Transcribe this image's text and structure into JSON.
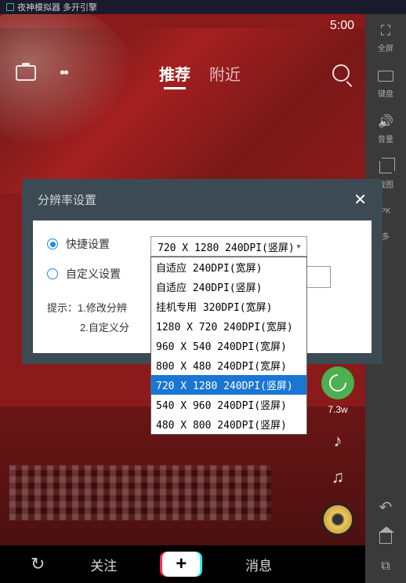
{
  "titlebar": {
    "text": "夜神模拟器 多开引擎"
  },
  "status": {
    "time": "5:00"
  },
  "topnav": {
    "tab_recommend": "推荐",
    "tab_nearby": "附近"
  },
  "right_actions": {
    "count": "7.3w"
  },
  "bottom_nav": {
    "follow": "关注",
    "plus": "+",
    "message": "消息"
  },
  "sidebar": {
    "fullscreen": "全屏",
    "keyboard": "键盘",
    "volume": "音量",
    "screenshot": "截图",
    "apk": "PK",
    "more": "多"
  },
  "modal": {
    "title": "分辨率设置",
    "radio_quick": "快捷设置",
    "radio_custom": "自定义设置",
    "selected_value": "720 X 1280 240DPI(竖屏)",
    "tip_line1": "提示：1.修改分辨",
    "tip_line2": "2.自定义分"
  },
  "dropdown": {
    "options": [
      "自适应 240DPI(宽屏)",
      "自适应 240DPI(竖屏)",
      "挂机专用 320DPI(宽屏)",
      "1280 X 720 240DPI(宽屏)",
      "960 X 540 240DPI(宽屏)",
      "800 X 480 240DPI(宽屏)",
      "720 X 1280 240DPI(竖屏)",
      "540 X 960 240DPI(竖屏)",
      "480 X 800 240DPI(竖屏)"
    ],
    "selected_index": 6
  }
}
